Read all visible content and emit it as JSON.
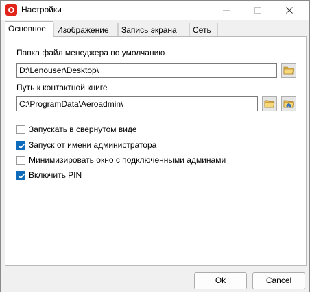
{
  "window": {
    "title": "Настройки"
  },
  "tabs": [
    {
      "label": "Основное",
      "active": true
    },
    {
      "label": "Изображение",
      "active": false
    },
    {
      "label": "Запись экрана",
      "active": false
    },
    {
      "label": "Сеть",
      "active": false
    }
  ],
  "general": {
    "file_manager_label": "Папка файл менеджера по умолчанию",
    "file_manager_path": "D:\\Lenouser\\Desktop\\",
    "contact_book_label": "Путь к контактной книге",
    "contact_book_path": "C:\\ProgramData\\Aeroadmin\\",
    "options": [
      {
        "label": "Запускать в свернутом виде",
        "checked": false
      },
      {
        "label": "Запуск от имени администратора",
        "checked": true
      },
      {
        "label": "Минимизировать окно с подключенными админами",
        "checked": false
      },
      {
        "label": "Включить PIN",
        "checked": true
      }
    ]
  },
  "footer": {
    "ok_label": "Ok",
    "cancel_label": "Cancel"
  },
  "icons": {
    "folder": "folder-icon",
    "folder_home": "folder-home-icon"
  },
  "colors": {
    "accent": "#0f6cbd",
    "app_icon": "#e2231a",
    "folder": "#e8b84a"
  }
}
